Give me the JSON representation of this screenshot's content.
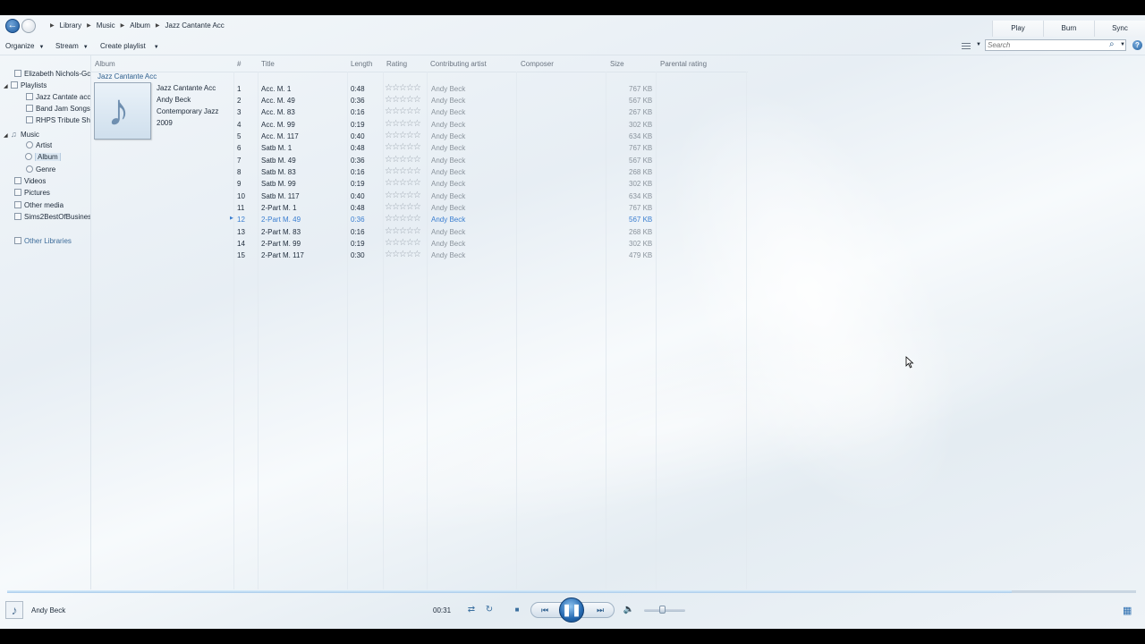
{
  "breadcrumb": [
    "Library",
    "Music",
    "Album",
    "Jazz Cantante Acc"
  ],
  "top_tabs": {
    "play": "Play",
    "burn": "Burn",
    "sync": "Sync"
  },
  "toolbar": {
    "organize": "Organize",
    "stream": "Stream",
    "create_playlist": "Create playlist",
    "search_placeholder": "Search"
  },
  "nav": {
    "user": "Elizabeth Nichols-Gc",
    "playlists": "Playlists",
    "playlist_items": [
      "Jazz Cantate acco",
      "Band Jam Songs",
      "RHPS Tribute Sho"
    ],
    "music": "Music",
    "music_items": [
      "Artist",
      "Album",
      "Genre"
    ],
    "videos": "Videos",
    "pictures": "Pictures",
    "other_media": "Other media",
    "sims": "Sims2BestOfBusines",
    "other_libraries": "Other Libraries"
  },
  "columns": {
    "album": "Album",
    "num": "#",
    "title": "Title",
    "length": "Length",
    "rating": "Rating",
    "artist": "Contributing artist",
    "composer": "Composer",
    "size": "Size",
    "parental": "Parental rating"
  },
  "album": {
    "group_label": "Jazz Cantante Acc",
    "title": "Jazz Cantante Acc",
    "artist": "Andy Beck",
    "genre": "Contemporary Jazz",
    "year": "2009"
  },
  "tracks": [
    {
      "num": "1",
      "title": "Acc. M. 1",
      "length": "0:48",
      "artist": "Andy Beck",
      "size": "767 KB",
      "rating": "☆☆☆☆☆"
    },
    {
      "num": "2",
      "title": "Acc. M. 49",
      "length": "0:36",
      "artist": "Andy Beck",
      "size": "567 KB",
      "rating": "☆☆☆☆☆"
    },
    {
      "num": "3",
      "title": "Acc. M. 83",
      "length": "0:16",
      "artist": "Andy Beck",
      "size": "267 KB",
      "rating": "☆☆☆☆☆"
    },
    {
      "num": "4",
      "title": "Acc. M. 99",
      "length": "0:19",
      "artist": "Andy Beck",
      "size": "302 KB",
      "rating": "☆☆☆☆☆"
    },
    {
      "num": "5",
      "title": "Acc. M. 117",
      "length": "0:40",
      "artist": "Andy Beck",
      "size": "634 KB",
      "rating": "☆☆☆☆☆"
    },
    {
      "num": "6",
      "title": "Satb M. 1",
      "length": "0:48",
      "artist": "Andy Beck",
      "size": "767 KB",
      "rating": "☆☆☆☆☆"
    },
    {
      "num": "7",
      "title": "Satb M. 49",
      "length": "0:36",
      "artist": "Andy Beck",
      "size": "567 KB",
      "rating": "☆☆☆☆☆"
    },
    {
      "num": "8",
      "title": "Satb M. 83",
      "length": "0:16",
      "artist": "Andy Beck",
      "size": "268 KB",
      "rating": "☆☆☆☆☆"
    },
    {
      "num": "9",
      "title": "Satb M. 99",
      "length": "0:19",
      "artist": "Andy Beck",
      "size": "302 KB",
      "rating": "☆☆☆☆☆"
    },
    {
      "num": "10",
      "title": "Satb M. 117",
      "length": "0:40",
      "artist": "Andy Beck",
      "size": "634 KB",
      "rating": "☆☆☆☆☆"
    },
    {
      "num": "11",
      "title": "2-Part M. 1",
      "length": "0:48",
      "artist": "Andy Beck",
      "size": "767 KB",
      "rating": "☆☆☆☆☆"
    },
    {
      "num": "12",
      "title": "2-Part M. 49",
      "length": "0:36",
      "artist": "Andy Beck",
      "size": "567 KB",
      "rating": "☆☆☆☆☆",
      "playing": true
    },
    {
      "num": "13",
      "title": "2-Part M. 83",
      "length": "0:16",
      "artist": "Andy Beck",
      "size": "268 KB",
      "rating": "☆☆☆☆☆"
    },
    {
      "num": "14",
      "title": "2-Part M. 99",
      "length": "0:19",
      "artist": "Andy Beck",
      "size": "302 KB",
      "rating": "☆☆☆☆☆"
    },
    {
      "num": "15",
      "title": "2-Part M. 117",
      "length": "0:30",
      "artist": "Andy Beck",
      "size": "479 KB",
      "rating": "☆☆☆☆☆"
    }
  ],
  "player": {
    "now_playing_artist": "Andy Beck",
    "elapsed": "00:31",
    "seek_progress_percent": 89,
    "volume_percent": 45
  },
  "icons": {
    "back": "back-arrow-icon",
    "forward": "forward-arrow-icon",
    "search": "search-icon",
    "help": "help-icon",
    "play_pause": "pause-icon"
  }
}
